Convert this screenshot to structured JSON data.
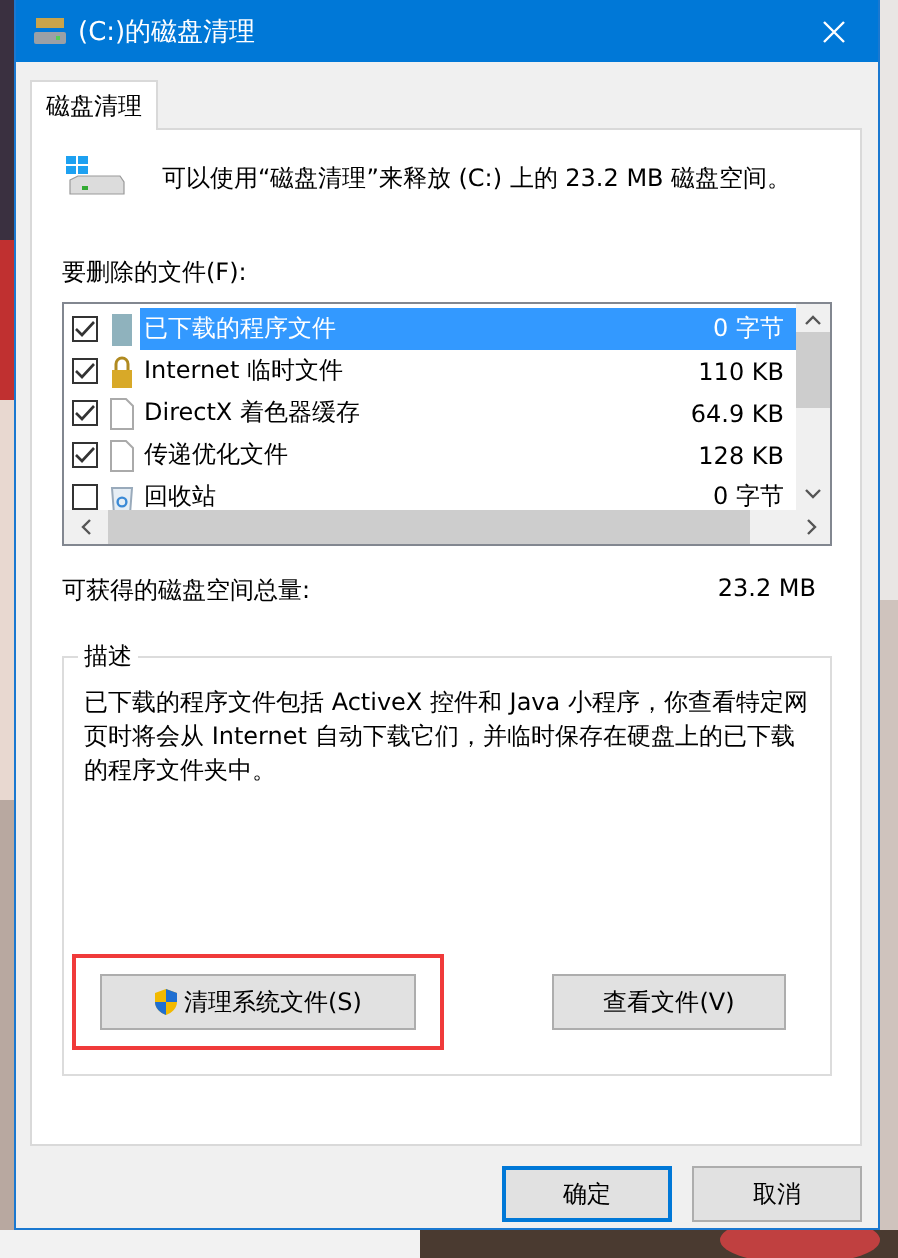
{
  "window": {
    "title": "(C:)的磁盘清理"
  },
  "tabs": [
    {
      "label": "磁盘清理",
      "selected": true
    }
  ],
  "intro": "可以使用“磁盘清理”来释放 (C:) 上的 23.2 MB 磁盘空间。",
  "files_label": "要删除的文件(F):",
  "files": [
    {
      "kind": "program",
      "name": "已下载的程序文件",
      "size": "0 字节",
      "checked": true,
      "selected": true
    },
    {
      "kind": "lock",
      "name": "Internet 临时文件",
      "size": "110 KB",
      "checked": true,
      "selected": false
    },
    {
      "kind": "file",
      "name": "DirectX 着色器缓存",
      "size": "64.9 KB",
      "checked": true,
      "selected": false
    },
    {
      "kind": "file",
      "name": "传递优化文件",
      "size": "128 KB",
      "checked": true,
      "selected": false
    },
    {
      "kind": "recycle",
      "name": "回收站",
      "size": "0 字节",
      "checked": false,
      "selected": false
    }
  ],
  "total": {
    "label": "可获得的磁盘空间总量:",
    "value": "23.2 MB"
  },
  "description": {
    "title": "描述",
    "text": "已下载的程序文件包括 ActiveX 控件和 Java 小程序，你查看特定网页时将会从 Internet 自动下载它们，并临时保存在硬盘上的已下载的程序文件夹中。"
  },
  "panel_buttons": [
    {
      "kind": "shield",
      "label": "清理系统文件(S)",
      "highlighted": true
    },
    {
      "kind": "plain",
      "label": "查看文件(V)",
      "highlighted": false
    }
  ],
  "dialog_buttons": [
    {
      "label": "确定",
      "default": true
    },
    {
      "label": "取消",
      "default": false
    }
  ]
}
